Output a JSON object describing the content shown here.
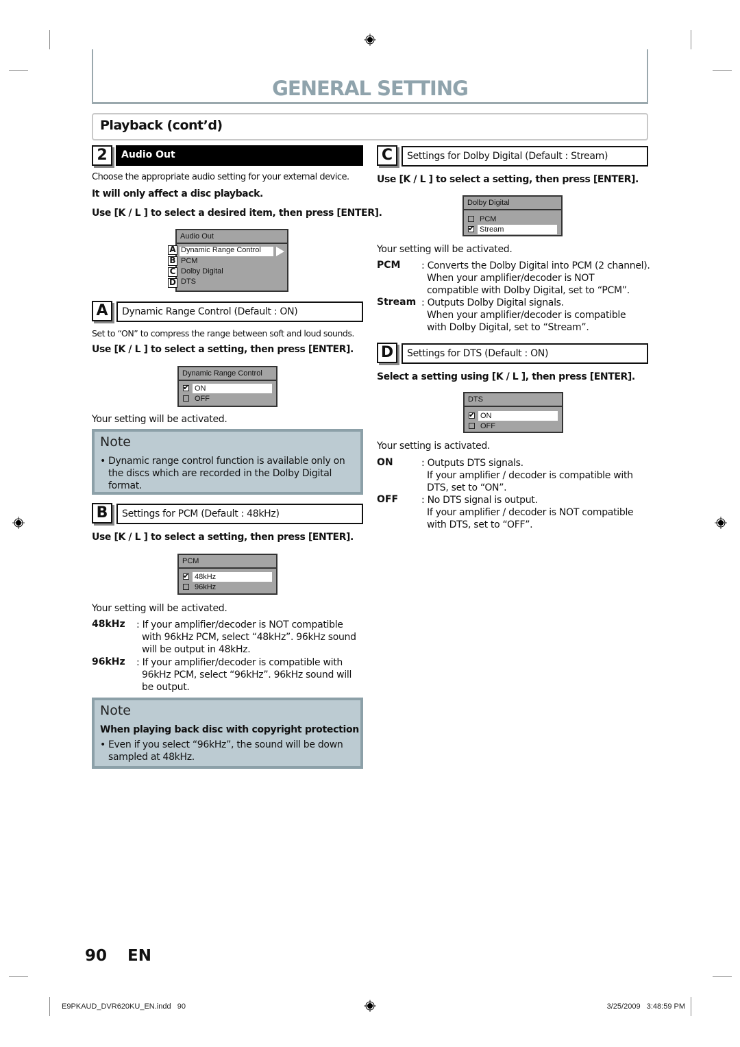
{
  "header": {
    "title": "GENERAL SETTING",
    "subtitle": "Playback (cont’d)"
  },
  "colors": {
    "title": "#8fa3ac",
    "note_bg": "#bccbd2",
    "note_border": "#8ca0a8",
    "osd_bg": "#a4a4a4"
  },
  "step2": {
    "number": "2",
    "title": "Audio Out",
    "intro": "Choose the appropriate audio setting for your external device.",
    "note_bold": "It will only affect a disc playback.",
    "instruction": "Use [K / L ] to select a desired item, then press [ENTER].",
    "menu": {
      "title": "Audio Out",
      "items": [
        {
          "tag": "A",
          "label": "Dynamic Range Control",
          "selected": true
        },
        {
          "tag": "B",
          "label": "PCM",
          "selected": false
        },
        {
          "tag": "C",
          "label": "Dolby Digital",
          "selected": false
        },
        {
          "tag": "D",
          "label": "DTS",
          "selected": false
        }
      ],
      "arrow_icon": "right-triangle"
    }
  },
  "sectionA": {
    "letter": "A",
    "title": "Dynamic Range Control (Default : ON)",
    "desc": "Set to “ON” to compress the range between soft and loud sounds.",
    "instruction": "Use [K / L ] to select a setting, then press [ENTER].",
    "menu": {
      "title": "Dynamic Range Control",
      "options": [
        {
          "label": "ON",
          "checked": true,
          "selected": true
        },
        {
          "label": "OFF",
          "checked": false,
          "selected": false
        }
      ]
    },
    "result": "Your setting will be activated.",
    "note": {
      "title": "Note",
      "bullets": [
        "Dynamic range control function is available only on the discs which are recorded in the Dolby Digital format."
      ]
    }
  },
  "sectionB": {
    "letter": "B",
    "title": "Settings for PCM (Default : 48kHz)",
    "instruction": "Use [K / L ] to select a setting, then press [ENTER].",
    "menu": {
      "title": "PCM",
      "options": [
        {
          "label": "48kHz",
          "checked": true,
          "selected": true
        },
        {
          "label": "96kHz",
          "checked": false,
          "selected": false
        }
      ]
    },
    "result": "Your setting will be activated.",
    "definitions": [
      {
        "term": "48kHz",
        "lines": [
          ": If your amplifier/decoder is NOT compatible",
          "with 96kHz PCM, select “48kHz”. 96kHz sound",
          "will be output in 48kHz."
        ]
      },
      {
        "term": "96kHz",
        "lines": [
          ": If your amplifier/decoder is compatible with",
          "96kHz PCM, select “96kHz”. 96kHz sound will",
          "be output."
        ]
      }
    ],
    "note": {
      "title": "Note",
      "heading": "When playing back disc with copyright protection",
      "bullets": [
        "Even if you select “96kHz”, the sound will be down sampled at 48kHz."
      ]
    }
  },
  "sectionC": {
    "letter": "C",
    "title": "Settings for Dolby Digital (Default : Stream)",
    "instruction": "Use [K / L ] to select a setting, then press [ENTER].",
    "menu": {
      "title": "Dolby Digital",
      "options": [
        {
          "label": "PCM",
          "checked": false,
          "selected": false
        },
        {
          "label": "Stream",
          "checked": true,
          "selected": true
        }
      ]
    },
    "result": "Your setting will be activated.",
    "definitions": [
      {
        "term": "PCM",
        "lines": [
          ": Converts the Dolby Digital into PCM (2 channel).",
          "When your amplifier/decoder is NOT",
          "compatible with Dolby Digital, set to “PCM”."
        ]
      },
      {
        "term": "Stream",
        "lines": [
          ": Outputs Dolby Digital signals.",
          "When your amplifier/decoder is compatible",
          "with Dolby Digital, set to “Stream”."
        ]
      }
    ]
  },
  "sectionD": {
    "letter": "D",
    "title": "Settings for DTS (Default : ON)",
    "instruction": "Select a setting using [K / L ], then press [ENTER].",
    "menu": {
      "title": "DTS",
      "options": [
        {
          "label": "ON",
          "checked": true,
          "selected": true
        },
        {
          "label": "OFF",
          "checked": false,
          "selected": false
        }
      ]
    },
    "result": "Your setting is activated.",
    "definitions": [
      {
        "term": "ON",
        "lines": [
          ": Outputs DTS signals.",
          "If your amplifier / decoder is compatible with",
          "DTS, set to “ON”."
        ]
      },
      {
        "term": "OFF",
        "lines": [
          ": No DTS signal is output.",
          "If your amplifier / decoder is NOT compatible",
          "with DTS, set to “OFF”."
        ]
      }
    ]
  },
  "page": {
    "number": "90",
    "lang": "EN"
  },
  "footer": {
    "file": "E9PKAUD_DVR620KU_EN.indd   90",
    "timestamp": "3/25/2009   3:48:59 PM"
  }
}
